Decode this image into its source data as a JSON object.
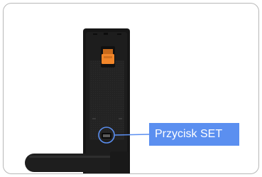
{
  "callout": {
    "label": "Przycisk SET",
    "color": "#5b8ff0"
  },
  "illustration": {
    "subject": "smart-door-lock-inner-panel",
    "icons": [
      "battery-cover-icon",
      "set-button-icon",
      "door-handle-icon"
    ]
  }
}
